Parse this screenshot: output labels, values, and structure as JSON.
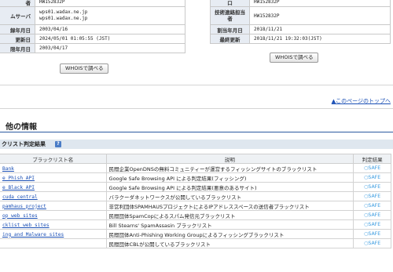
{
  "whois_left": {
    "rows": [
      {
        "label": "者",
        "value": "HW152832P"
      },
      {
        "label": "ムサーバ",
        "value": "wps01.wadax.ne.jp\nwps01.wadax.ne.jp"
      },
      {
        "label": "録年月日",
        "value": "2003/04/16"
      },
      {
        "label": "更新日",
        "value": "2024/05/01 01:05:55 (JST)"
      },
      {
        "label": "限年月日",
        "value": "2003/04/17"
      }
    ],
    "button_label": "WHOISで調べる"
  },
  "whois_right": {
    "rows": [
      {
        "label": "口",
        "value": "HW152832P"
      },
      {
        "label": "技術連絡担当者",
        "value": "HW152832P"
      },
      {
        "label": "割当年月日",
        "value": "2018/11/21"
      },
      {
        "label": "最終更新",
        "value": "2018/11/21 19:32:03(JST)"
      }
    ],
    "button_label": "WHOISで調べる"
  },
  "page_top_link": "▲このページのトップへ",
  "section_title": "他の情報",
  "blacklist": {
    "header_title": "クリスト判定結果",
    "help_icon": "question-icon",
    "columns": [
      "ブラックリスト名",
      "説明",
      "判定結果"
    ],
    "rows": [
      {
        "name": "Bank",
        "desc": "民間企業OpenDNSの無料コミュニティーが運営するフィッシングサイトのブラックリスト",
        "status": "○SAFE"
      },
      {
        "name": "e Phish API",
        "desc": "Google Safe Browsing API による判定結果(フィッシング)",
        "status": "○SAFE"
      },
      {
        "name": "e Black API",
        "desc": "Google Safe Browsing API による判定結果(悪意のあるサイト)",
        "status": "○SAFE"
      },
      {
        "name": "cuda central",
        "desc": "バラクーダネットワークスが公開しているブラックリスト",
        "status": "○SAFE"
      },
      {
        "name": "pamhaus project",
        "desc": "非営利団体SPAMHAUSプロジェクトによるIPアドレススペースの送信者ブラックリスト",
        "status": "○SAFE"
      },
      {
        "name": "op web sites",
        "desc": "民間団体SpamCopによるスパム発信元ブラックリスト",
        "status": "○SAFE"
      },
      {
        "name": "cklist web sites",
        "desc": "Bill Stearns' SpamAssasin ブラックリスト",
        "status": "○SAFE"
      },
      {
        "name": "ing and Malware sites",
        "desc": "民間団体Anti-Phishing Working Groupによるフィッシングブラックリスト",
        "status": "○SAFE"
      },
      {
        "name": "",
        "desc": "民間団体CBLが公開しているブラックリスト",
        "status": "○SAFE"
      }
    ]
  },
  "colors": {
    "link": "#1a4fb5",
    "safe": "#3a9be0",
    "label_bg": "#e7ecf3",
    "header_bg": "#dfe7ef",
    "accent_rule": "#2c5aa0"
  }
}
